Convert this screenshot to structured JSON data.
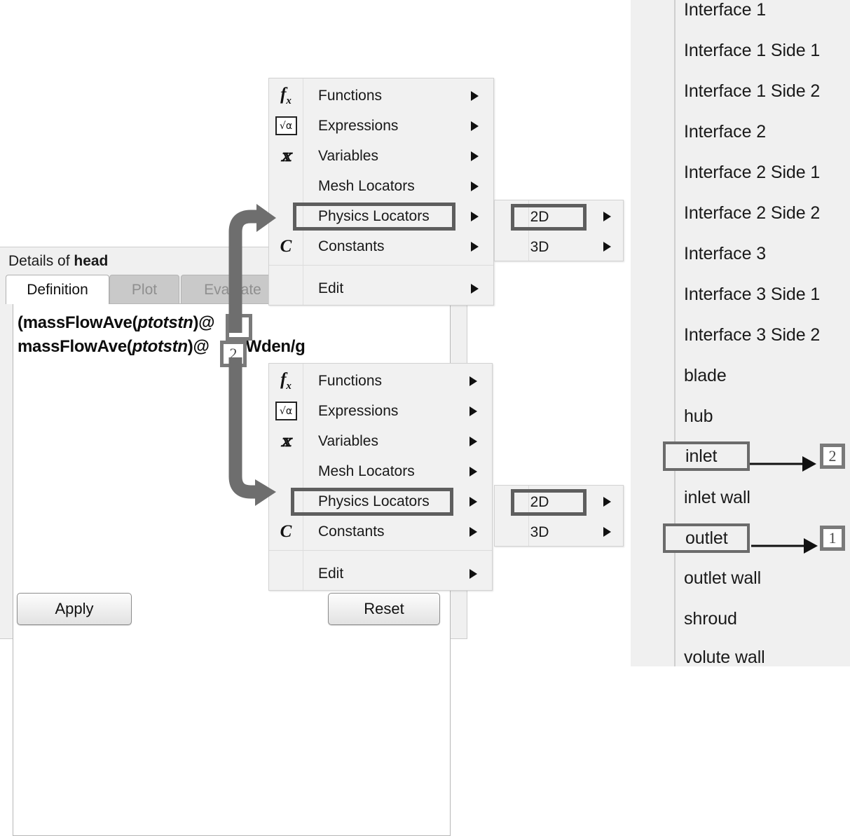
{
  "details": {
    "title_prefix": "Details of ",
    "title_name": "head",
    "tabs": [
      {
        "label": "Definition",
        "state": "active"
      },
      {
        "label": "Plot",
        "state": "disabled"
      },
      {
        "label": "Evaluate",
        "state": "disabled"
      }
    ],
    "expression": {
      "line1_a": "(massFlowAve(",
      "line1_italic": "ptotstn",
      "line1_b": ")@",
      "line1_c": "-",
      "line2_a": "massFlowAve(",
      "line2_italic": "ptotstn",
      "line2_b": ")@",
      "line2_c": ")/Wden/g",
      "full_text": "(massFlowAve(ptotstn)@[1]-massFlowAve(ptotstn)@[2])/Wden/g"
    },
    "apply_label": "Apply",
    "reset_label": "Reset"
  },
  "context_menu": {
    "items": [
      {
        "label": "Functions",
        "icon": "fx-icon",
        "glyph": "fx",
        "arrow": true
      },
      {
        "label": "Expressions",
        "icon": "sqrt-alpha-icon",
        "glyph": "√α",
        "arrow": true
      },
      {
        "label": "Variables",
        "icon": "variables-x-icon",
        "glyph": "𝔛",
        "arrow": true
      },
      {
        "label": "Mesh Locators",
        "icon": "none",
        "glyph": "",
        "arrow": true
      },
      {
        "label": "Physics Locators",
        "icon": "none",
        "glyph": "",
        "arrow": true,
        "highlighted": true
      },
      {
        "label": "Constants",
        "icon": "constant-c-icon",
        "glyph": "C",
        "arrow": true
      },
      {
        "label": "Edit",
        "icon": "none",
        "glyph": "",
        "arrow": true
      }
    ]
  },
  "submenu": {
    "items": [
      {
        "label": "2D",
        "arrow": true,
        "highlighted": true
      },
      {
        "label": "3D",
        "arrow": true,
        "highlighted": false
      }
    ]
  },
  "object_list": {
    "items": [
      {
        "label": "Interface 1",
        "boxed": false,
        "badge": null
      },
      {
        "label": "Interface 1 Side 1",
        "boxed": false,
        "badge": null
      },
      {
        "label": "Interface 1 Side 2",
        "boxed": false,
        "badge": null
      },
      {
        "label": "Interface 2",
        "boxed": false,
        "badge": null
      },
      {
        "label": "Interface 2 Side 1",
        "boxed": false,
        "badge": null
      },
      {
        "label": "Interface 2 Side 2",
        "boxed": false,
        "badge": null
      },
      {
        "label": "Interface 3",
        "boxed": false,
        "badge": null
      },
      {
        "label": "Interface 3 Side 1",
        "boxed": false,
        "badge": null
      },
      {
        "label": "Interface 3 Side 2",
        "boxed": false,
        "badge": null
      },
      {
        "label": "blade",
        "boxed": false,
        "badge": null
      },
      {
        "label": "hub",
        "boxed": false,
        "badge": null
      },
      {
        "label": "inlet",
        "boxed": true,
        "badge": "2"
      },
      {
        "label": "inlet wall",
        "boxed": false,
        "badge": null
      },
      {
        "label": "outlet",
        "boxed": true,
        "badge": "1"
      },
      {
        "label": "outlet wall",
        "boxed": false,
        "badge": null
      },
      {
        "label": "shroud",
        "boxed": false,
        "badge": null
      },
      {
        "label": "volute wall",
        "boxed": false,
        "badge": null
      }
    ]
  },
  "callouts": {
    "marker_1": "1",
    "marker_2": "2"
  },
  "colors": {
    "menu_bg": "#f1f1f1",
    "panel_bg": "#f0f0f0",
    "highlight_border": "#5e5e5e",
    "callout_arrow": "#6e6e6e",
    "badge_border": "#7a7a7a",
    "text": "#191919"
  }
}
